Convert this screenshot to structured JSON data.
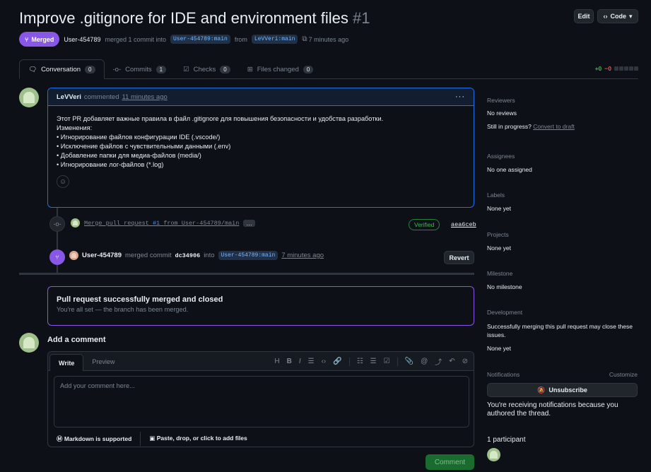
{
  "header": {
    "title": "Improve .gitignore for IDE and environment files",
    "number": "#1",
    "edit_label": "Edit",
    "code_label": "Code"
  },
  "meta": {
    "state": "Merged",
    "author": "User-454789",
    "merged_text": "merged 1 commit into",
    "base": "User-454789:main",
    "from_text": "from",
    "head": "LeVVeri:main",
    "time": "7 minutes ago"
  },
  "tabs": [
    {
      "label": "Conversation",
      "count": "0"
    },
    {
      "label": "Commits",
      "count": "1"
    },
    {
      "label": "Checks",
      "count": "0"
    },
    {
      "label": "Files changed",
      "count": "0"
    }
  ],
  "diffstat": {
    "add": "+0",
    "del": "−0"
  },
  "comment": {
    "author": "LeVVeri",
    "action": "commented",
    "time": "11 minutes ago",
    "lines": [
      "Этот PR добавляет важные правила в файл .gitignore для повышения безопасности и удобства разработки.",
      "Изменения:",
      "• Игнорирование файлов конфигурации IDE (.vscode/)",
      "• Исключение файлов с чувствительными данными (.env)",
      "• Добавление папки для медиа-файлов (media/)",
      "• Игнорирование лог-файлов (*.log)"
    ]
  },
  "commit": {
    "message_a": "Merge pull request",
    "message_num": "#1",
    "message_b": "from User-454789/main",
    "more": "…",
    "verified": "Verified",
    "sha": "aea6ceb"
  },
  "merge_event": {
    "user": "User-454789",
    "text": "merged commit",
    "sha": "dc34906",
    "into": "into",
    "branch": "User-454789:main",
    "time": "7 minutes ago",
    "revert": "Revert"
  },
  "merged_box": {
    "title": "Pull request successfully merged and closed",
    "subtitle": "You're all set — the branch has been merged."
  },
  "editor": {
    "heading": "Add a comment",
    "write": "Write",
    "preview": "Preview",
    "placeholder": "Add your comment here...",
    "markdown": "Markdown is supported",
    "attach": "Paste, drop, or click to add files",
    "submit": "Comment"
  },
  "sidebar": {
    "reviewers_label": "Reviewers",
    "reviewers_value": "No reviews",
    "in_progress": "Still in progress?",
    "convert": "Convert to draft",
    "assignees_label": "Assignees",
    "assignees_value": "No one assigned",
    "labels_label": "Labels",
    "labels_value": "None yet",
    "projects_label": "Projects",
    "projects_value": "None yet",
    "milestone_label": "Milestone",
    "milestone_value": "No milestone",
    "development_label": "Development",
    "development_text": "Successfully merging this pull request may close these issues.",
    "development_value": "None yet",
    "notifications_label": "Notifications",
    "customize": "Customize",
    "unsubscribe": "Unsubscribe",
    "notif_text": "You're receiving notifications because you authored the thread.",
    "participants": "1 participant"
  }
}
